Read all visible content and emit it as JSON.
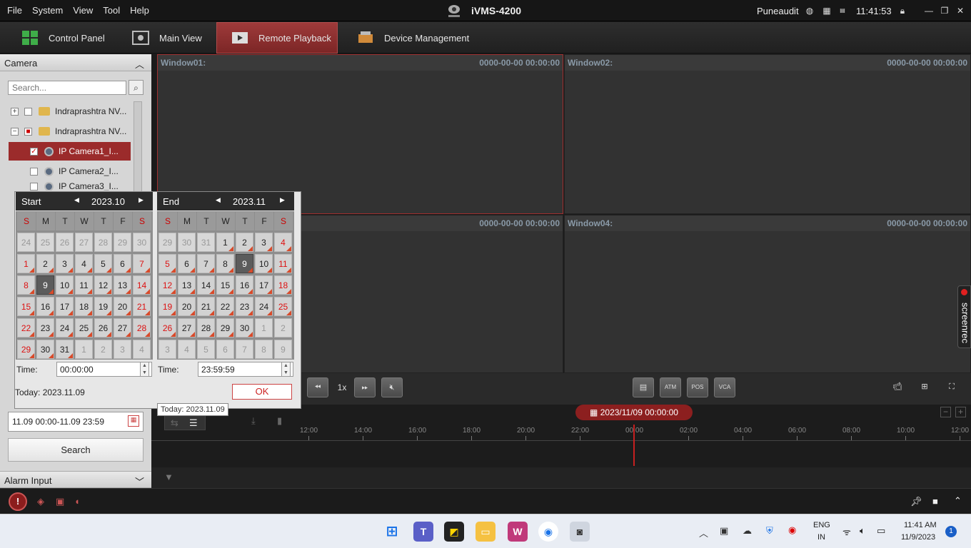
{
  "titlebar": {
    "menu": [
      "File",
      "System",
      "View",
      "Tool",
      "Help"
    ],
    "app_title": "iVMS-4200",
    "user": "Puneaudit",
    "clock": "11:41:53"
  },
  "nav": {
    "tabs": [
      "Control Panel",
      "Main View",
      "Remote Playback",
      "Device Management"
    ],
    "active": "Remote Playback"
  },
  "left": {
    "camera_header": "Camera",
    "search_placeholder": "Search...",
    "tree": [
      "Indraprashtra NV...",
      "Indraprashtra NV...",
      "IP Camera1_I...",
      "IP Camera2_I...",
      "IP Camera3_I..."
    ],
    "range": "11.09 00:00-11.09 23:59",
    "search_button": "Search",
    "alarm_header": "Alarm Input"
  },
  "windows": [
    {
      "name": "Window01:",
      "time": "0000-00-00 00:00:00"
    },
    {
      "name": "Window02:",
      "time": "0000-00-00 00:00:00"
    },
    {
      "name": "",
      "time": "0000-00-00 00:00:00"
    },
    {
      "name": "Window04:",
      "time": "0000-00-00 00:00:00"
    }
  ],
  "controls": {
    "speed": "1x"
  },
  "timeline": {
    "date": "2023/11/09 00:00:00",
    "ticks": [
      "12:00",
      "14:00",
      "16:00",
      "18:00",
      "20:00",
      "22:00",
      "00:00",
      "02:00",
      "04:00",
      "06:00",
      "08:00",
      "10:00",
      "12:00"
    ]
  },
  "calendar": {
    "start": {
      "label": "Start",
      "month": "2023.10",
      "time_label": "Time:",
      "time": "00:00:00",
      "days": [
        "24",
        "25",
        "26",
        "27",
        "28",
        "29",
        "30",
        "1",
        "2",
        "3",
        "4",
        "5",
        "6",
        "7",
        "8",
        "9",
        "10",
        "11",
        "12",
        "13",
        "14",
        "15",
        "16",
        "17",
        "18",
        "19",
        "20",
        "21",
        "22",
        "23",
        "24",
        "25",
        "26",
        "27",
        "28",
        "29",
        "30",
        "31",
        "1",
        "2",
        "3",
        "4"
      ]
    },
    "end": {
      "label": "End",
      "month": "2023.11",
      "time_label": "Time:",
      "time": "23:59:59",
      "days": [
        "29",
        "30",
        "31",
        "1",
        "2",
        "3",
        "4",
        "5",
        "6",
        "7",
        "8",
        "9",
        "10",
        "11",
        "12",
        "13",
        "14",
        "15",
        "16",
        "17",
        "18",
        "19",
        "20",
        "21",
        "22",
        "23",
        "24",
        "25",
        "26",
        "27",
        "28",
        "29",
        "30",
        "1",
        "2",
        "3",
        "4",
        "5",
        "6",
        "7",
        "8",
        "9"
      ]
    },
    "dow": [
      "S",
      "M",
      "T",
      "W",
      "T",
      "F",
      "S"
    ],
    "today": "Today: 2023.11.09",
    "ok": "OK"
  },
  "tooltip": "Today: 2023.11.09",
  "screenrec": "screenrec",
  "taskbar": {
    "lang1": "ENG",
    "lang2": "IN",
    "time": "11:41 AM",
    "date": "11/9/2023",
    "badge": "1"
  }
}
